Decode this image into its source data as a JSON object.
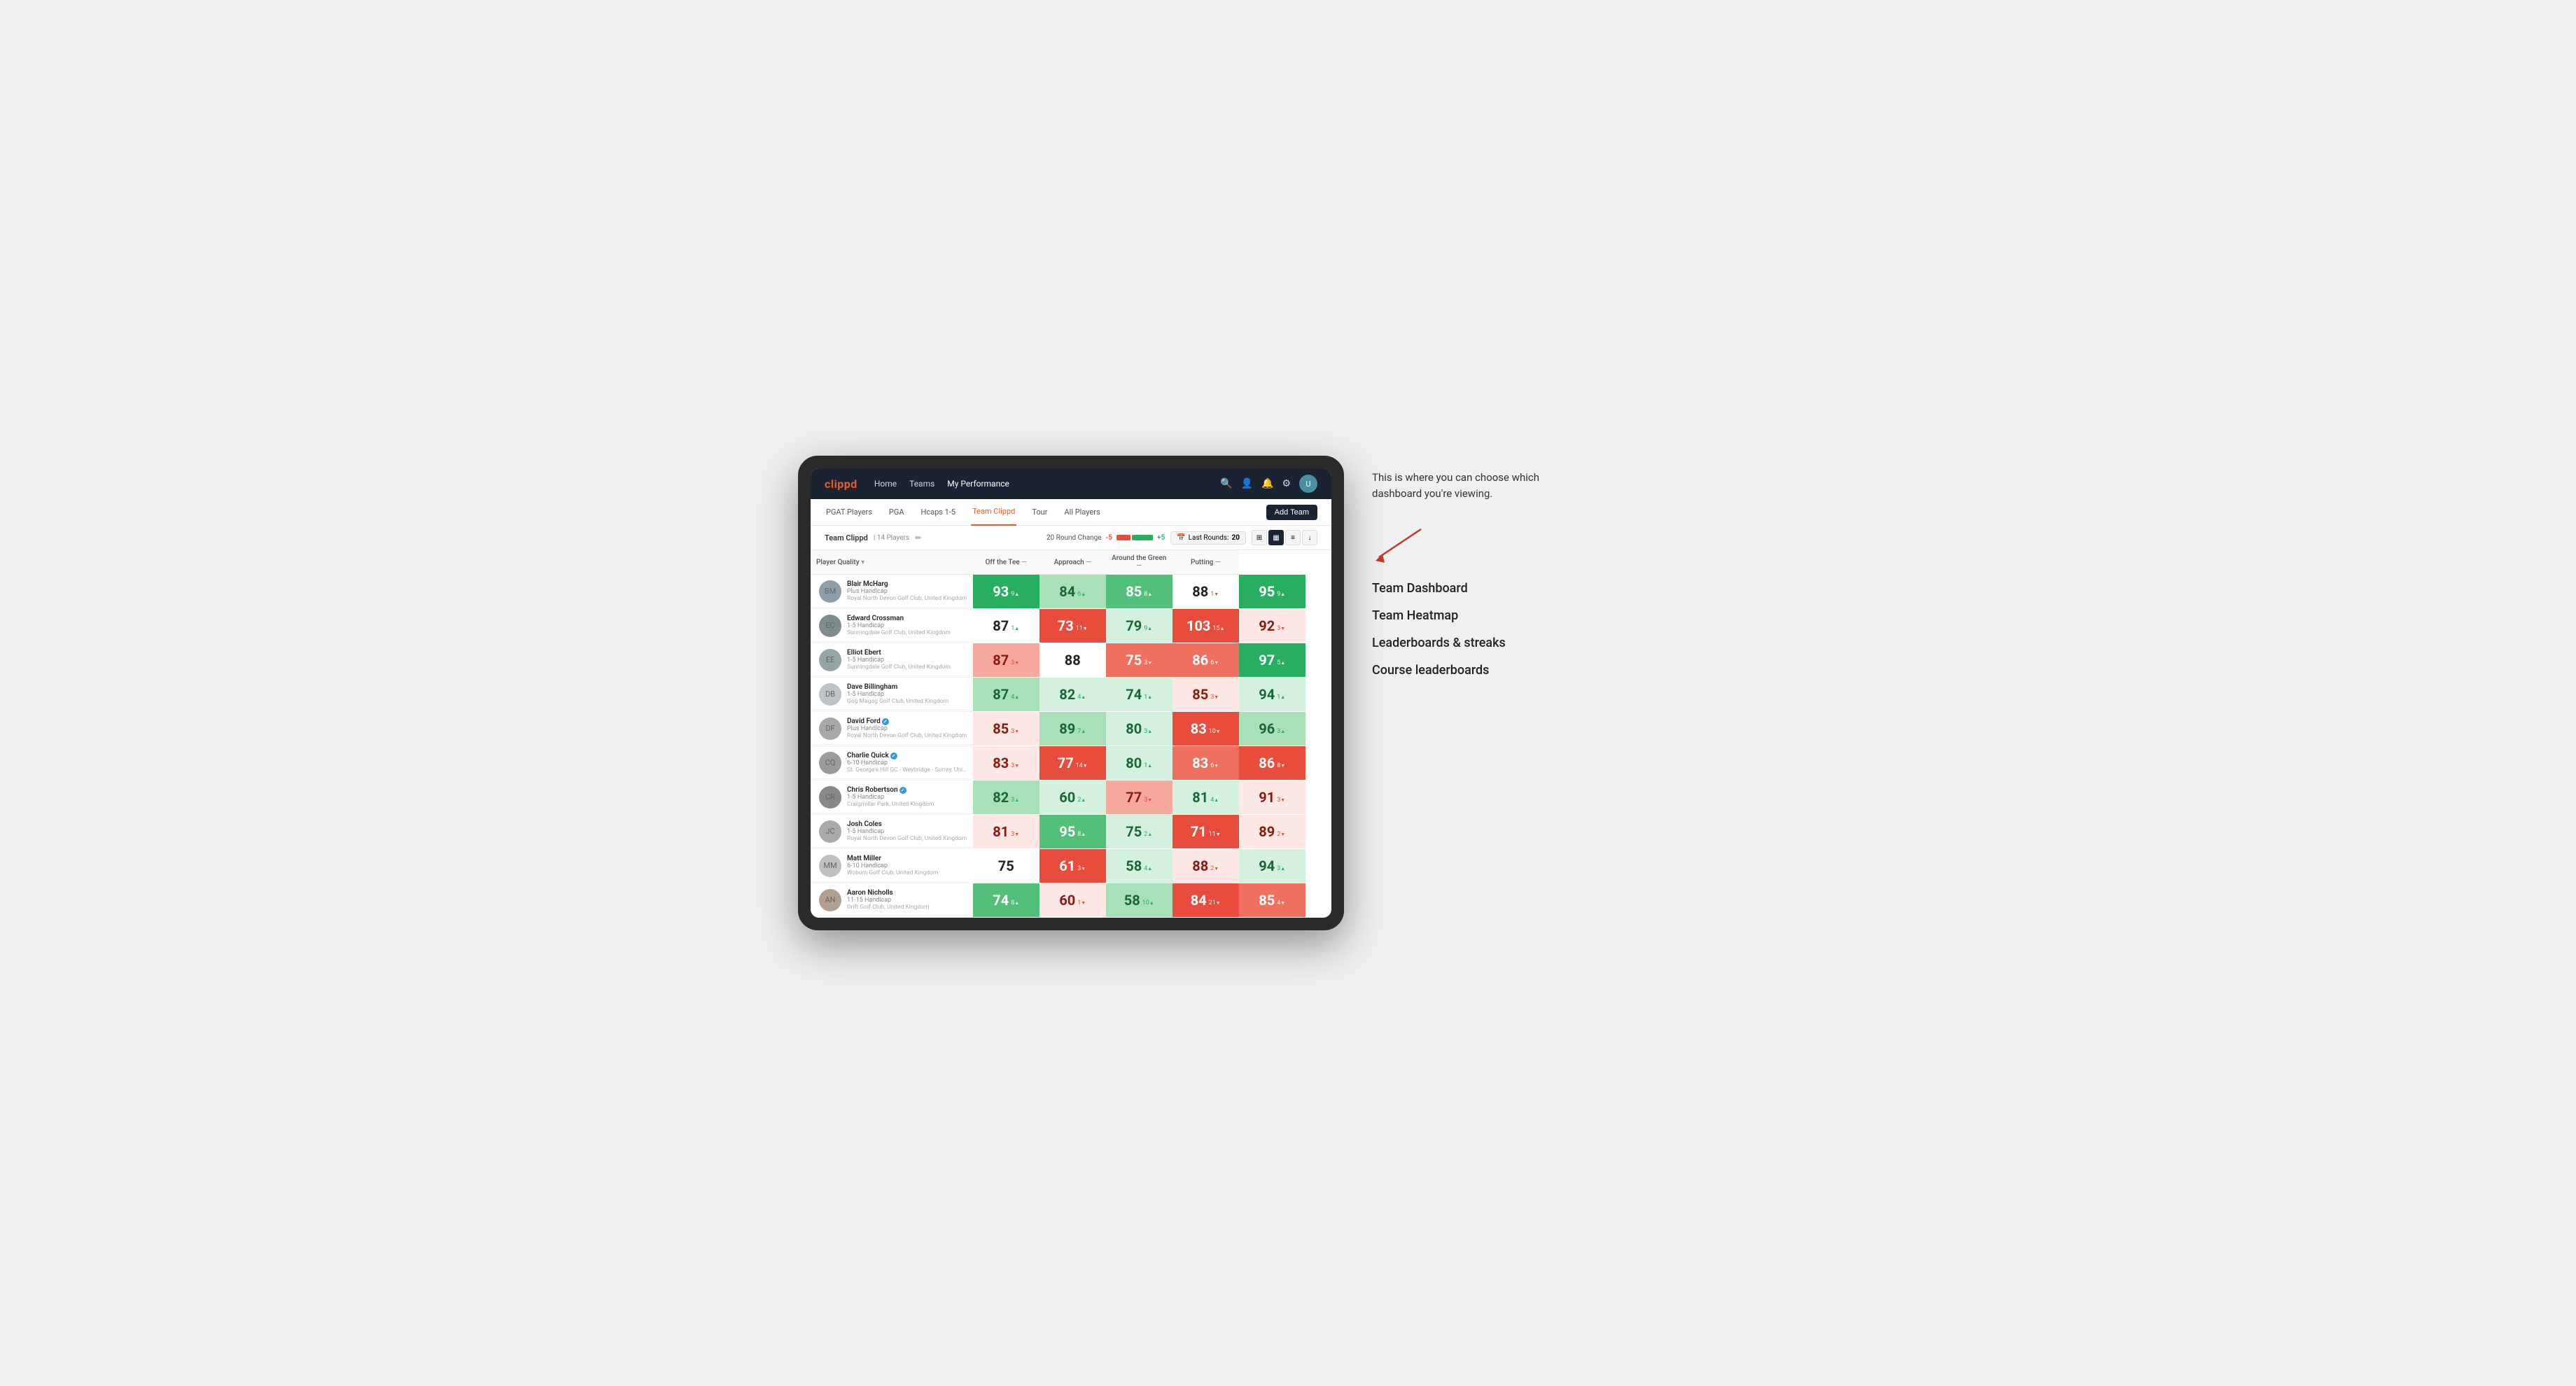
{
  "annotation": {
    "description": "This is where you can choose which dashboard you're viewing.",
    "options": [
      "Team Dashboard",
      "Team Heatmap",
      "Leaderboards & streaks",
      "Course leaderboards"
    ]
  },
  "nav": {
    "logo": "clippd",
    "links": [
      "Home",
      "Teams",
      "My Performance"
    ],
    "active_link": "My Performance"
  },
  "subnav": {
    "links": [
      "PGAT Players",
      "PGA",
      "Hcaps 1-5",
      "Team Clippd",
      "Tour",
      "All Players"
    ],
    "active_link": "Team Clippd",
    "add_team_label": "Add Team"
  },
  "team_header": {
    "name": "Team Clippd",
    "separator": "|",
    "count": "14 Players",
    "round_change_label": "20 Round Change",
    "change_negative": "-5",
    "change_positive": "+5",
    "last_rounds_label": "Last Rounds:",
    "last_rounds_value": "20"
  },
  "table": {
    "columns": {
      "player": "Player Quality",
      "off_tee": "Off the Tee",
      "approach": "Approach",
      "around_green": "Around the Green",
      "putting": "Putting"
    },
    "players": [
      {
        "name": "Blair McHarg",
        "handicap": "Plus Handicap",
        "club": "Royal North Devon Golf Club, United Kingdom",
        "scores": {
          "player_quality": {
            "value": "93",
            "change": "9",
            "dir": "up",
            "bg": "bg-green-strong"
          },
          "off_tee": {
            "value": "84",
            "change": "6",
            "dir": "up",
            "bg": "bg-green-light"
          },
          "approach": {
            "value": "85",
            "change": "8",
            "dir": "up",
            "bg": "bg-green-medium"
          },
          "around_green": {
            "value": "88",
            "change": "1",
            "dir": "down",
            "bg": "bg-white"
          },
          "putting": {
            "value": "95",
            "change": "9",
            "dir": "up",
            "bg": "bg-green-strong"
          }
        }
      },
      {
        "name": "Edward Crossman",
        "handicap": "1-5 Handicap",
        "club": "Sunningdale Golf Club, United Kingdom",
        "scores": {
          "player_quality": {
            "value": "87",
            "change": "1",
            "dir": "up",
            "bg": "bg-white"
          },
          "off_tee": {
            "value": "73",
            "change": "11",
            "dir": "down",
            "bg": "bg-red-strong"
          },
          "approach": {
            "value": "79",
            "change": "9",
            "dir": "up",
            "bg": "bg-very-light-green"
          },
          "around_green": {
            "value": "103",
            "change": "15",
            "dir": "up",
            "bg": "bg-red-strong"
          },
          "putting": {
            "value": "92",
            "change": "3",
            "dir": "down",
            "bg": "bg-very-light-red"
          }
        }
      },
      {
        "name": "Elliot Ebert",
        "handicap": "1-5 Handicap",
        "club": "Sunningdale Golf Club, United Kingdom",
        "scores": {
          "player_quality": {
            "value": "87",
            "change": "3",
            "dir": "down",
            "bg": "bg-red-light"
          },
          "off_tee": {
            "value": "88",
            "change": "",
            "dir": "",
            "bg": "bg-white"
          },
          "approach": {
            "value": "75",
            "change": "3",
            "dir": "down",
            "bg": "bg-red-medium"
          },
          "around_green": {
            "value": "86",
            "change": "6",
            "dir": "down",
            "bg": "bg-red-medium"
          },
          "putting": {
            "value": "97",
            "change": "5",
            "dir": "up",
            "bg": "bg-green-strong"
          }
        }
      },
      {
        "name": "Dave Billingham",
        "handicap": "1-5 Handicap",
        "club": "Gog Magog Golf Club, United Kingdom",
        "scores": {
          "player_quality": {
            "value": "87",
            "change": "4",
            "dir": "up",
            "bg": "bg-green-light"
          },
          "off_tee": {
            "value": "82",
            "change": "4",
            "dir": "up",
            "bg": "bg-very-light-green"
          },
          "approach": {
            "value": "74",
            "change": "1",
            "dir": "up",
            "bg": "bg-very-light-green"
          },
          "around_green": {
            "value": "85",
            "change": "3",
            "dir": "down",
            "bg": "bg-very-light-red"
          },
          "putting": {
            "value": "94",
            "change": "1",
            "dir": "up",
            "bg": "bg-very-light-green"
          }
        }
      },
      {
        "name": "David Ford",
        "handicap": "Plus Handicap",
        "club": "Royal North Devon Golf Club, United Kingdom",
        "verified": true,
        "scores": {
          "player_quality": {
            "value": "85",
            "change": "3",
            "dir": "down",
            "bg": "bg-very-light-red"
          },
          "off_tee": {
            "value": "89",
            "change": "7",
            "dir": "up",
            "bg": "bg-green-light"
          },
          "approach": {
            "value": "80",
            "change": "3",
            "dir": "up",
            "bg": "bg-very-light-green"
          },
          "around_green": {
            "value": "83",
            "change": "10",
            "dir": "down",
            "bg": "bg-red-strong"
          },
          "putting": {
            "value": "96",
            "change": "3",
            "dir": "up",
            "bg": "bg-green-light"
          }
        }
      },
      {
        "name": "Charlie Quick",
        "handicap": "6-10 Handicap",
        "club": "St. George's Hill GC - Weybridge - Surrey, Uni...",
        "verified": true,
        "scores": {
          "player_quality": {
            "value": "83",
            "change": "3",
            "dir": "down",
            "bg": "bg-very-light-red"
          },
          "off_tee": {
            "value": "77",
            "change": "14",
            "dir": "down",
            "bg": "bg-red-strong"
          },
          "approach": {
            "value": "80",
            "change": "1",
            "dir": "up",
            "bg": "bg-very-light-green"
          },
          "around_green": {
            "value": "83",
            "change": "6",
            "dir": "down",
            "bg": "bg-red-medium"
          },
          "putting": {
            "value": "86",
            "change": "8",
            "dir": "down",
            "bg": "bg-red-strong"
          }
        }
      },
      {
        "name": "Chris Robertson",
        "handicap": "1-5 Handicap",
        "club": "Craigmillar Park, United Kingdom",
        "verified": true,
        "scores": {
          "player_quality": {
            "value": "82",
            "change": "3",
            "dir": "up",
            "bg": "bg-green-light"
          },
          "off_tee": {
            "value": "60",
            "change": "2",
            "dir": "up",
            "bg": "bg-very-light-green"
          },
          "approach": {
            "value": "77",
            "change": "3",
            "dir": "down",
            "bg": "bg-red-light"
          },
          "around_green": {
            "value": "81",
            "change": "4",
            "dir": "up",
            "bg": "bg-very-light-green"
          },
          "putting": {
            "value": "91",
            "change": "3",
            "dir": "down",
            "bg": "bg-very-light-red"
          }
        }
      },
      {
        "name": "Josh Coles",
        "handicap": "1-5 Handicap",
        "club": "Royal North Devon Golf Club, United Kingdom",
        "scores": {
          "player_quality": {
            "value": "81",
            "change": "3",
            "dir": "down",
            "bg": "bg-very-light-red"
          },
          "off_tee": {
            "value": "95",
            "change": "8",
            "dir": "up",
            "bg": "bg-green-medium"
          },
          "approach": {
            "value": "75",
            "change": "2",
            "dir": "up",
            "bg": "bg-very-light-green"
          },
          "around_green": {
            "value": "71",
            "change": "11",
            "dir": "down",
            "bg": "bg-red-strong"
          },
          "putting": {
            "value": "89",
            "change": "2",
            "dir": "down",
            "bg": "bg-very-light-red"
          }
        }
      },
      {
        "name": "Matt Miller",
        "handicap": "6-10 Handicap",
        "club": "Woburn Golf Club, United Kingdom",
        "scores": {
          "player_quality": {
            "value": "75",
            "change": "",
            "dir": "",
            "bg": "bg-white"
          },
          "off_tee": {
            "value": "61",
            "change": "3",
            "dir": "down",
            "bg": "bg-red-strong"
          },
          "approach": {
            "value": "58",
            "change": "4",
            "dir": "up",
            "bg": "bg-very-light-green"
          },
          "around_green": {
            "value": "88",
            "change": "2",
            "dir": "down",
            "bg": "bg-very-light-red"
          },
          "putting": {
            "value": "94",
            "change": "3",
            "dir": "up",
            "bg": "bg-very-light-green"
          }
        }
      },
      {
        "name": "Aaron Nicholls",
        "handicap": "11-15 Handicap",
        "club": "Drift Golf Club, United Kingdom",
        "scores": {
          "player_quality": {
            "value": "74",
            "change": "8",
            "dir": "up",
            "bg": "bg-green-medium"
          },
          "off_tee": {
            "value": "60",
            "change": "1",
            "dir": "down",
            "bg": "bg-very-light-red"
          },
          "approach": {
            "value": "58",
            "change": "10",
            "dir": "up",
            "bg": "bg-green-light"
          },
          "around_green": {
            "value": "84",
            "change": "21",
            "dir": "down",
            "bg": "bg-red-strong"
          },
          "putting": {
            "value": "85",
            "change": "4",
            "dir": "down",
            "bg": "bg-red-medium"
          }
        }
      }
    ]
  },
  "colors": {
    "accent": "#e85d26",
    "nav_bg": "#1a2332",
    "green_strong": "#27ae60",
    "red_strong": "#e74c3c"
  }
}
